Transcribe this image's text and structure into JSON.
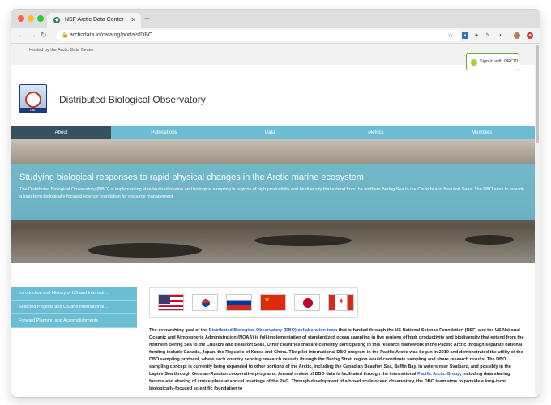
{
  "browser": {
    "tab_title": "NSF Arctic Data Center",
    "url": "arcticdata.io/catalog/portals/DBO"
  },
  "header": {
    "hosted_by": "Hosted by the Arctic Data Center",
    "signin_label": "Sign in with ORCID",
    "site_title": "Distributed Biological Observatory",
    "logo_caption": "DBO"
  },
  "menu": {
    "items": [
      "About",
      "Publications",
      "Data",
      "Metrics",
      "Members"
    ]
  },
  "hero": {
    "heading": "Studying biological responses to rapid physical changes in the Arctic marine ecosystem",
    "text": "The Distributed Biological Observatory (DBO) is implementing standardized marine and biological sampling in regions of high productivity and biodiversity that extend from the northern Bering Sea to the Chukchi and Beaufort Seas. The DBO aims to provide a long-term biologically-focused science foundation for resource management."
  },
  "sidebar": {
    "items": [
      "Introduction and History of US and Internati…",
      "Selected Projects and US and International …",
      "Forward Planning and Accomplishments"
    ]
  },
  "content": {
    "p1_a": "The overarching goal of the ",
    "p1_link": "Distributed Biological Observatory (DBO) collaboration team",
    "p1_b": " that is funded through the US National Science Foundation (NSF) and the US National Oceanic and Atmospheric Administration (NOAA) is full-implementation of standardized ocean sampling in five regions of high productivity and biodiversity that extend from the northern Bering Sea to the Chukchi and Beaufort Seas. Other countries that are currently participating in this research framework in the Pacific Arctic through separate national funding include Canada, Japan, the Republic of Korea and China. The pilot international DBO program in the Pacific Arctic was begun in 2010 and demonstrated the utility of the DBO sampling protocol, where each country sending research vessels through the Bering Strait region would coordinate sampling and share research results. The DBO sampling concept is currently being expanded to other portions of the Arctic, including the Canadian Beaufort Sea, Baffin Bay, in waters near Svalbard, and possibly in the Laptev Sea through German-Russian cooperative programs. Annual review of DBO data is facilitated through the international ",
    "p1_link2": "Pacific Arctic Group",
    "p1_c": ", including data sharing forums and sharing of cruise plans at annual meetings of the PAG. Through development of a broad scale ocean observatory, the DBO team aims to provide a long-term biologically-focused scientific foundation to"
  },
  "colors": {
    "accent": "#6bbdd3",
    "menu_active": "#37505f",
    "link": "#2a5db0"
  }
}
